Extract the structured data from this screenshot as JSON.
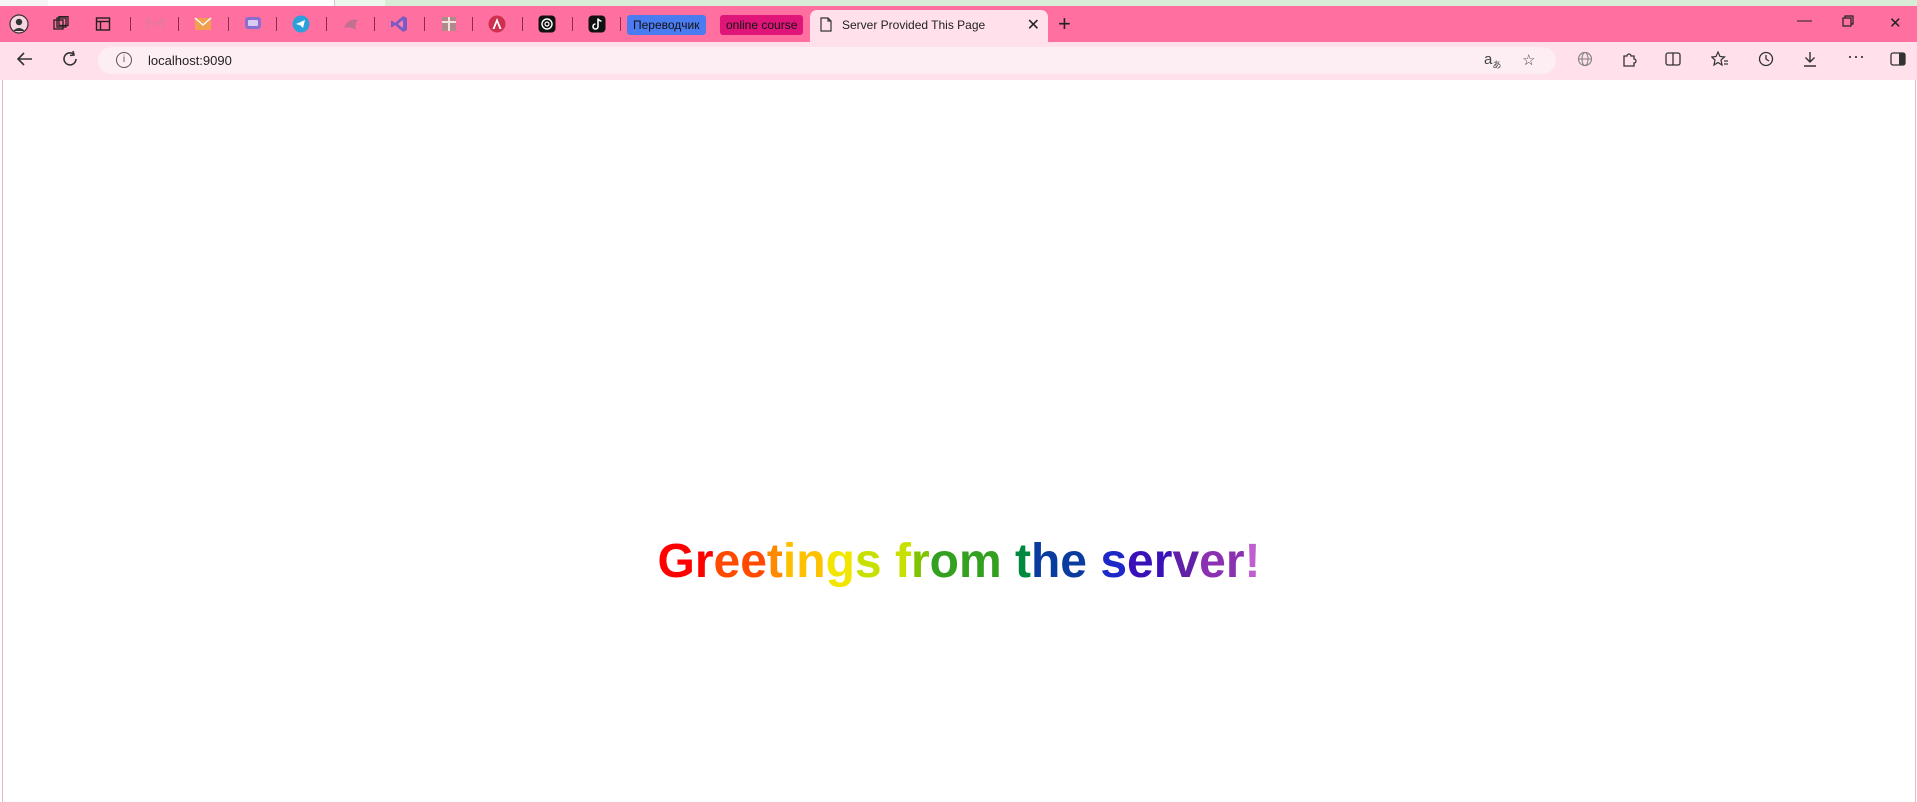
{
  "browser": {
    "pinned_tabs": [
      {
        "icon": "profile-icon",
        "color": "#222222"
      },
      {
        "icon": "workspaces-icon",
        "color": "#222222"
      },
      {
        "icon": "tab-actions-icon",
        "color": "#222222"
      },
      {
        "icon": "gmail-icon",
        "color": "#e67a9a"
      },
      {
        "icon": "mail-icon",
        "color": "#f0a050"
      },
      {
        "icon": "chat-icon",
        "color": "#8a6fd0"
      },
      {
        "icon": "telegram-icon",
        "color": "#2aa1da"
      },
      {
        "icon": "app-icon",
        "color": "#c07090"
      },
      {
        "icon": "visual-studio-icon",
        "color": "#7a5cc0"
      },
      {
        "icon": "bookmark-icon",
        "color": "#b08a8a"
      },
      {
        "icon": "angular-icon",
        "color": "#d03050"
      },
      {
        "icon": "chatgpt-icon",
        "color": "#111111"
      },
      {
        "icon": "tiktok-icon",
        "color": "#111111"
      }
    ],
    "chips": [
      {
        "label": "Переводчик",
        "bg": "#4a7bf0"
      },
      {
        "label": "online course",
        "bg": "#e0157a"
      }
    ],
    "active_tab": {
      "title": "Server Provided This Page"
    },
    "address": {
      "url": "localhost:9090"
    }
  },
  "page": {
    "greeting": "Greetings from the server!",
    "rainbow": [
      "#ff0000",
      "#ff4a00",
      "#ff8a00",
      "#ffc000",
      "#f2e600",
      "#c8e000",
      "#7fc400",
      "#33a020",
      "#008a40",
      "#0a3ca0",
      "#1e28c8",
      "#3a10b8",
      "#6020a8",
      "#8a30b0",
      "#c060d0"
    ]
  }
}
